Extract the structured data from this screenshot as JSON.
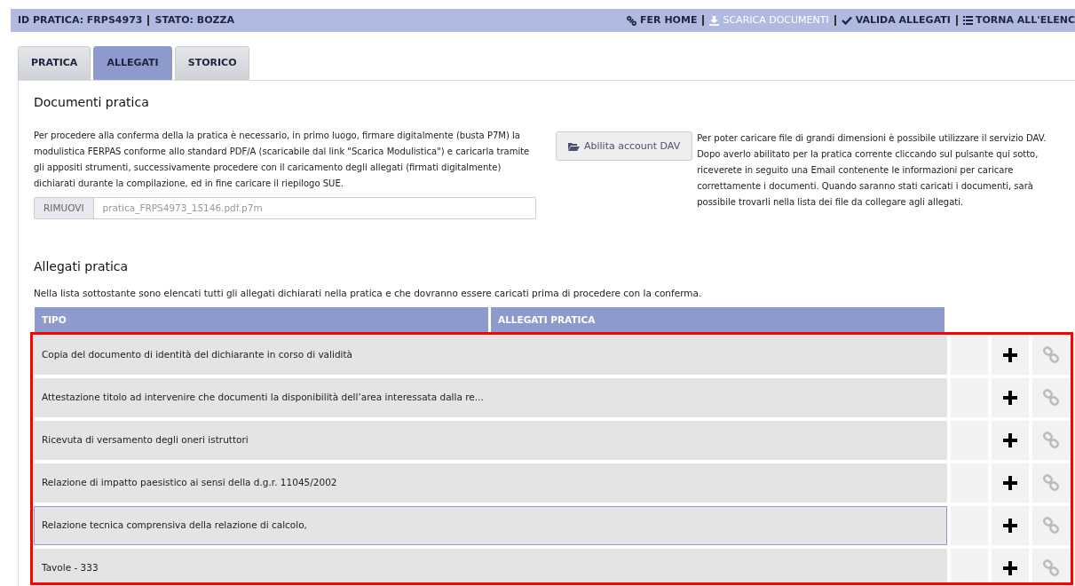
{
  "header": {
    "id_label": "ID PRATICA: FRPS4973",
    "status_label": "STATO: BOZZA",
    "actions": [
      {
        "kind": "home",
        "label": "FER HOME",
        "disabled": false
      },
      {
        "kind": "download",
        "label": "SCARICA DOCUMENTI",
        "disabled": true
      },
      {
        "kind": "validate",
        "label": "VALIDA ALLEGATI",
        "disabled": false
      },
      {
        "kind": "list",
        "label": "TORNA ALL'ELENC",
        "disabled": false
      }
    ]
  },
  "tabs": [
    {
      "label": "PRATICA",
      "selected": false
    },
    {
      "label": "ALLEGATI",
      "selected": true
    },
    {
      "label": "STORICO",
      "selected": false
    }
  ],
  "documents": {
    "title": "Documenti pratica",
    "intro": "Per procedere alla conferma della la pratica è necessario, in primo luogo, firmare digitalmente (busta P7M) la modulistica FERPAS conforme allo standard PDF/A (scaricabile dal link \"Scarica Modulistica\") e caricarla tramite gli appositi strumenti, successivamente procedere con il caricamento degli allegati (firmati digitalmente) dichiarati durante la compilazione, ed in fine caricare il riepilogo SUE.",
    "remove_button": "RIMUOVI",
    "file_value": "pratica_FRPS4973_15146.pdf.p7m",
    "dav_button": "Abilita account DAV",
    "dav_text": "Per poter caricare file di grandi dimensioni è possibile utilizzare il servizio DAV. Dopo averlo abilitato per la pratica corrente cliccando sul pulsante qui sotto, riceverete in seguito una Email contenente le informazioni per caricare correttamente i documenti. Quando saranno stati caricati i documenti, sarà possibile trovarli nella lista dei file da collegare agli allegati."
  },
  "attachments": {
    "title": "Allegati pratica",
    "intro": "Nella lista sottostante sono elencati tutti gli allegati dichiarati nella pratica e che dovranno essere caricati prima di procedere con la conferma.",
    "columns": [
      "TIPO",
      "ALLEGATI PRATICA"
    ],
    "rows": [
      {
        "tipo": "Copia del documento di identità del dichiarante in corso di validità",
        "selected": false
      },
      {
        "tipo": "Attestazione titolo ad intervenire che documenti la disponibilità dell’area interessata dalla re...",
        "selected": false
      },
      {
        "tipo": "Ricevuta di versamento degli oneri istruttori",
        "selected": false
      },
      {
        "tipo": "Relazione di impatto paesistico ai sensi della d.g.r. 11045/2002",
        "selected": false
      },
      {
        "tipo": "Relazione tecnica comprensiva della relazione di calcolo,",
        "selected": true
      },
      {
        "tipo": "Tavole - 333",
        "selected": false
      }
    ]
  }
}
